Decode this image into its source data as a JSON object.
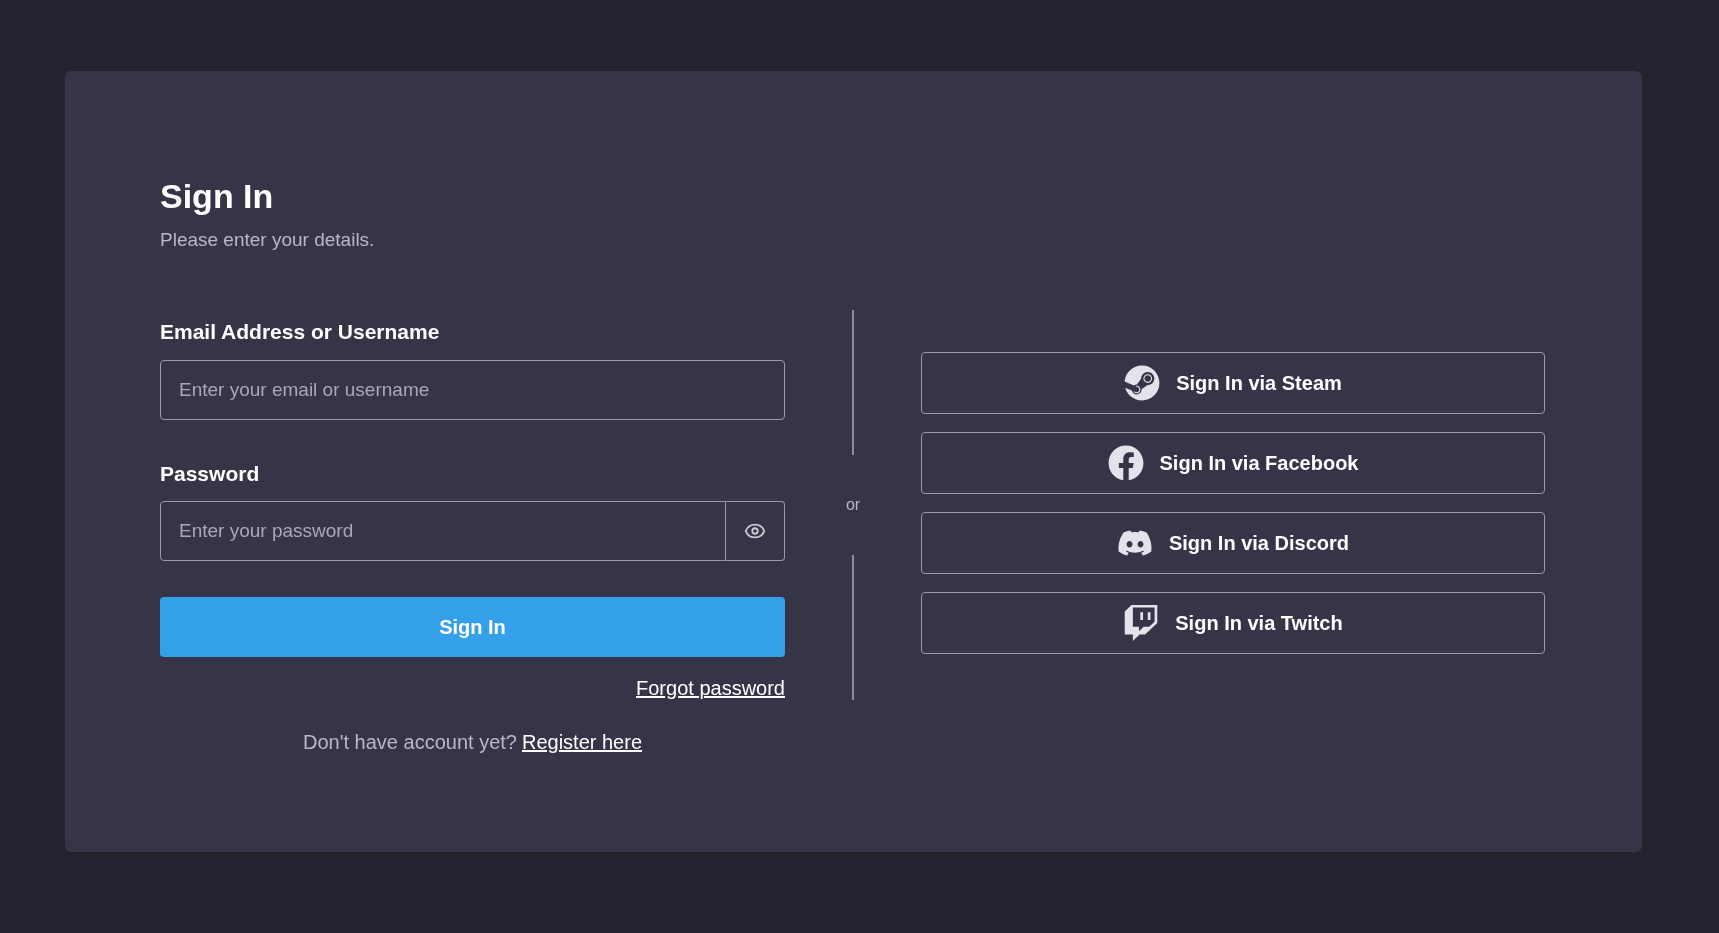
{
  "header": {
    "title": "Sign In",
    "subtitle": "Please enter your details."
  },
  "email_field": {
    "label": "Email Address or Username",
    "placeholder": "Enter your email or username"
  },
  "password_field": {
    "label": "Password",
    "placeholder": "Enter your password"
  },
  "sign_in_button": "Sign In",
  "forgot_link": "Forgot password",
  "register": {
    "prompt": "Don't have account yet?",
    "link": "Register here"
  },
  "divider_text": "or",
  "social_buttons": [
    {
      "kind": "steam",
      "label": "Sign In via Steam"
    },
    {
      "kind": "facebook",
      "label": "Sign In via Facebook"
    },
    {
      "kind": "discord",
      "label": "Sign In via Discord"
    },
    {
      "kind": "twitch",
      "label": "Sign In via Twitch"
    }
  ]
}
